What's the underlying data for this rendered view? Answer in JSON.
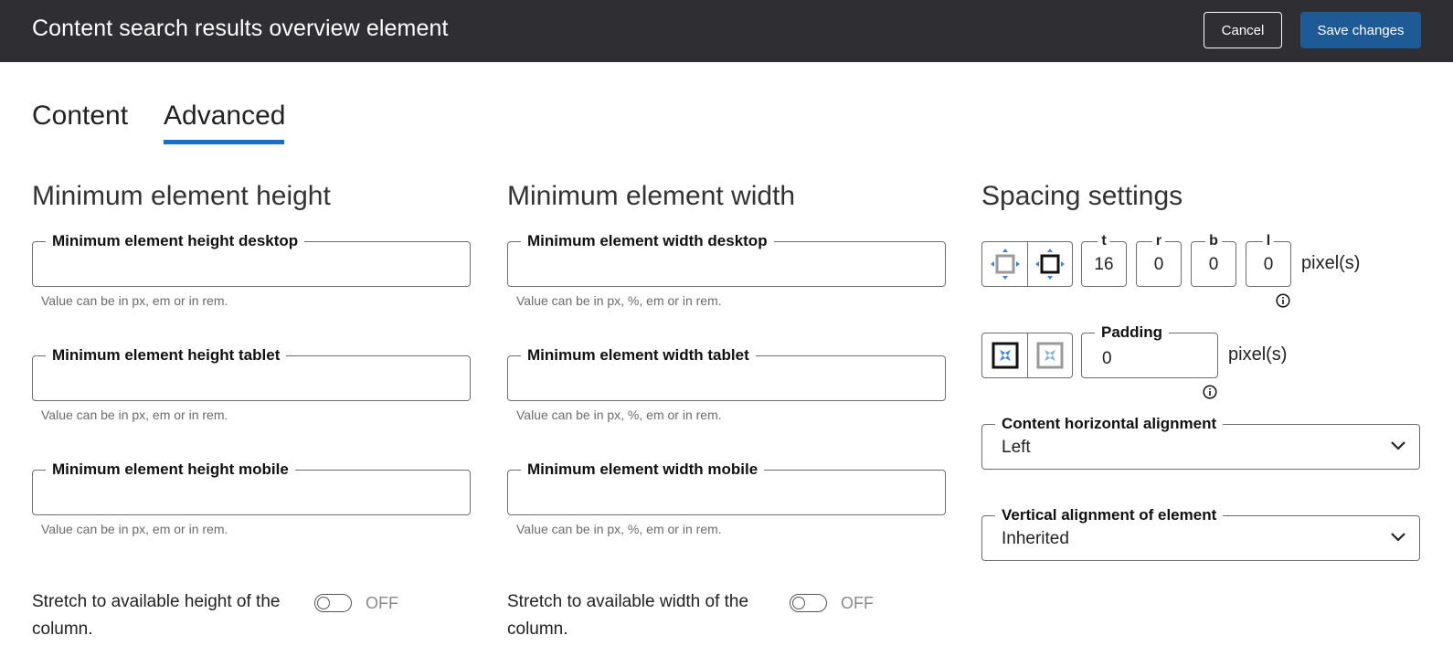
{
  "header": {
    "title": "Content search results overview element",
    "cancel_label": "Cancel",
    "save_label": "Save changes"
  },
  "tabs": [
    {
      "label": "Content",
      "active": false
    },
    {
      "label": "Advanced",
      "active": true
    }
  ],
  "height_section": {
    "heading": "Minimum element height",
    "fields": [
      {
        "label": "Minimum element height desktop",
        "value": "",
        "hint": "Value can be in px, em or in rem."
      },
      {
        "label": "Minimum element height tablet",
        "value": "",
        "hint": "Value can be in px, em or in rem."
      },
      {
        "label": "Minimum element height mobile",
        "value": "",
        "hint": "Value can be in px, em or in rem."
      }
    ],
    "stretch_label": "Stretch to available height of the column.",
    "stretch_state": "OFF"
  },
  "width_section": {
    "heading": "Minimum element width",
    "fields": [
      {
        "label": "Minimum element width desktop",
        "value": "",
        "hint": "Value can be in px, %, em or in rem."
      },
      {
        "label": "Minimum element width tablet",
        "value": "",
        "hint": "Value can be in px, %, em or in rem."
      },
      {
        "label": "Minimum element width mobile",
        "value": "",
        "hint": "Value can be in px, %, em or in rem."
      }
    ],
    "stretch_label": "Stretch to available width of the column.",
    "stretch_state": "OFF"
  },
  "spacing": {
    "heading": "Spacing settings",
    "margin": {
      "top_label": "t",
      "top_value": "16",
      "right_label": "r",
      "right_value": "0",
      "bottom_label": "b",
      "bottom_value": "0",
      "left_label": "l",
      "left_value": "0",
      "unit": "pixel(s)"
    },
    "padding": {
      "label": "Padding",
      "value": "0",
      "unit": "pixel(s)"
    },
    "horizontal_alignment": {
      "label": "Content horizontal alignment",
      "value": "Left"
    },
    "vertical_alignment": {
      "label": "Vertical alignment of element",
      "value": "Inherited"
    }
  },
  "colors": {
    "header_bg": "#2e2e33",
    "primary": "#1e5a96",
    "tab_underline": "#1a6fc0",
    "icon_accent": "#3a86d4"
  }
}
